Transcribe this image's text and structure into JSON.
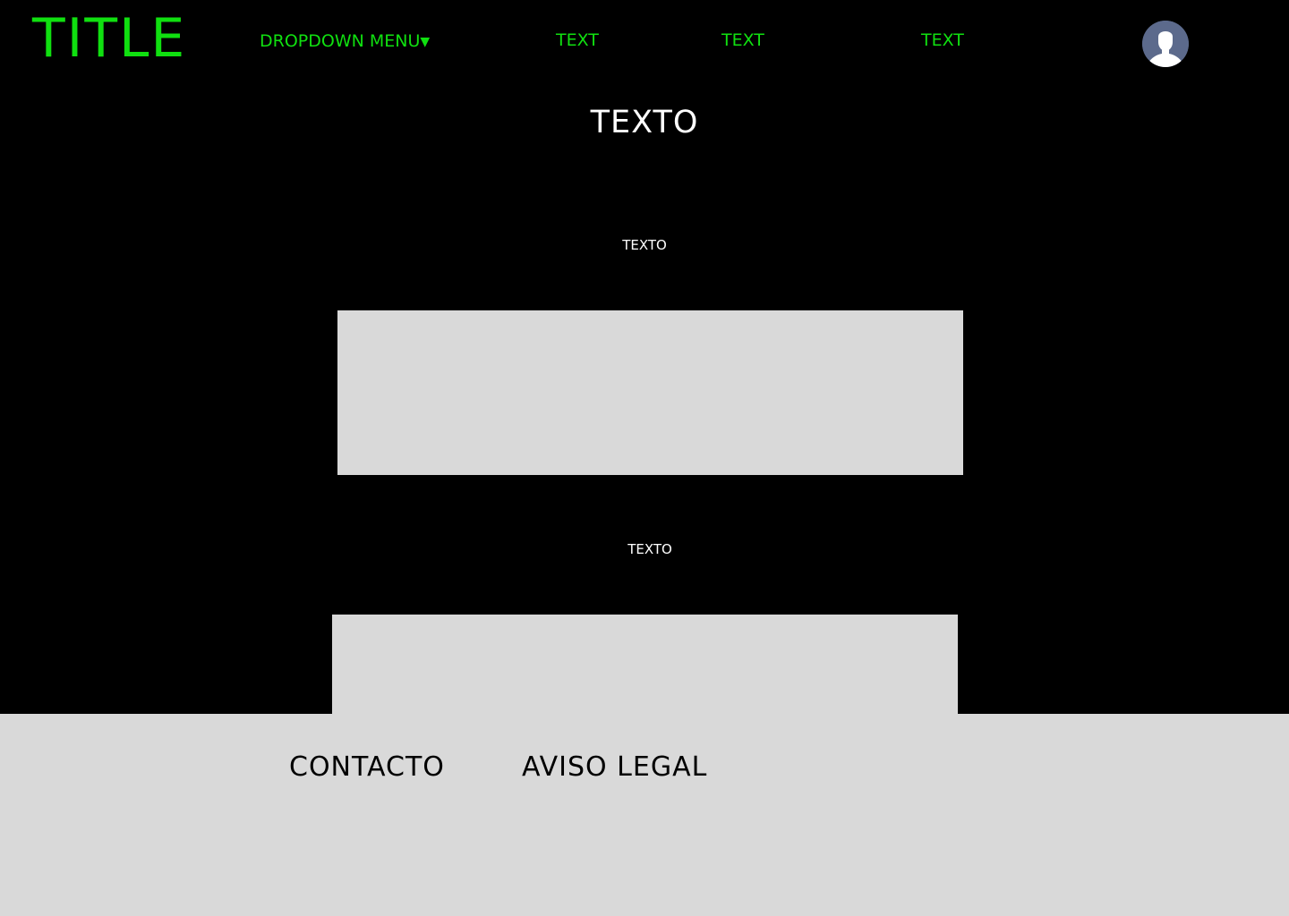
{
  "colors": {
    "background": "#000000",
    "accent": "#10e010",
    "text_light": "#ffffff",
    "placeholder": "#d9d9d9",
    "footer_text": "#000000",
    "avatar_bg": "#5c6a8c"
  },
  "nav": {
    "title": "TITLE",
    "dropdown_label": "DROPDOWN MENU",
    "dropdown_caret": "▼",
    "links": [
      "TEXT",
      "TEXT",
      "TEXT"
    ],
    "avatar_icon": "user-avatar-icon"
  },
  "main": {
    "heading": "TEXTO",
    "sections": [
      {
        "label": "TEXTO"
      },
      {
        "label": "TEXTO"
      }
    ]
  },
  "footer": {
    "links": [
      "CONTACTO",
      "AVISO LEGAL"
    ]
  }
}
